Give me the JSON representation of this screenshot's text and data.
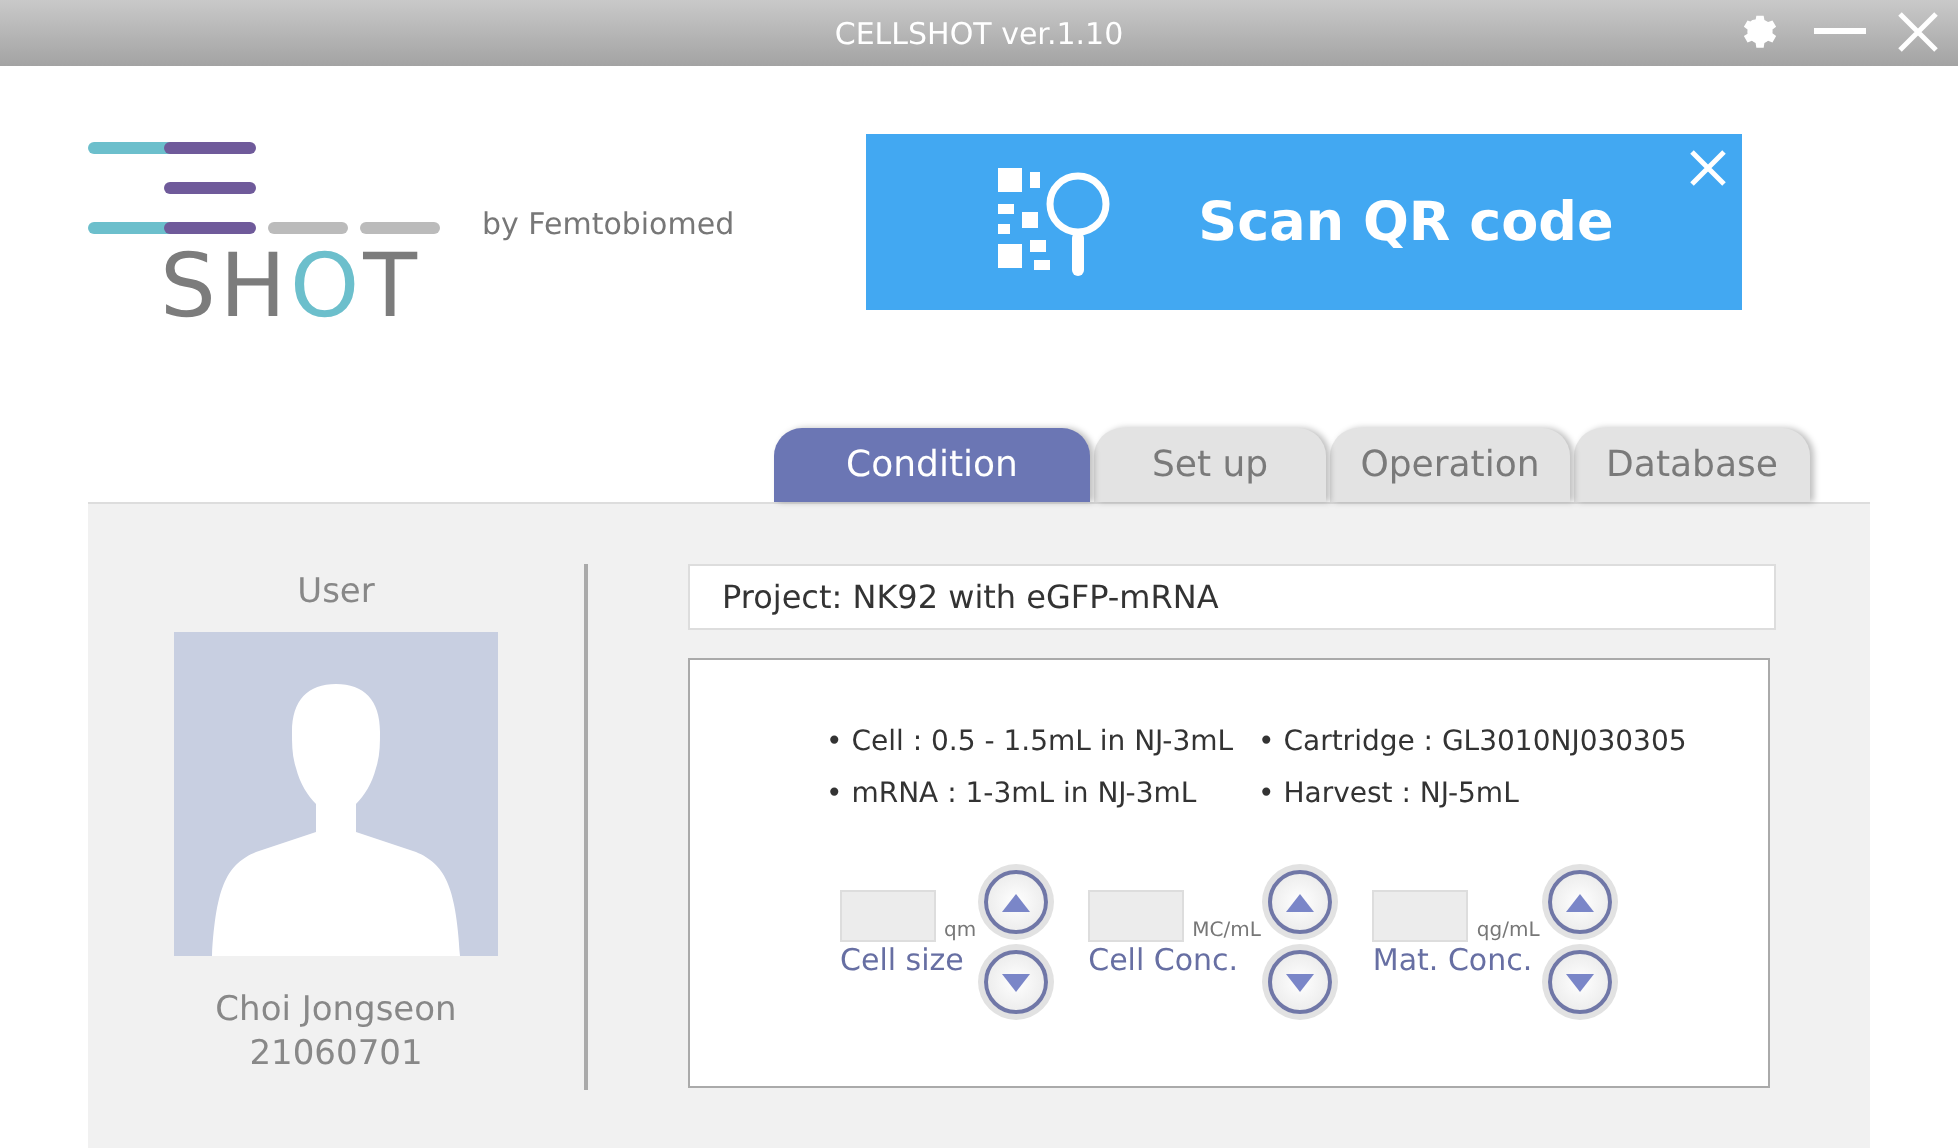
{
  "window": {
    "title": "CELLSHOT ver.1.10"
  },
  "logo": {
    "wordmark": "SHOT",
    "byline": "by Femtobiomed"
  },
  "banner": {
    "label": "Scan QR code"
  },
  "tabs": [
    {
      "label": "Condition",
      "selected": true
    },
    {
      "label": "Set up",
      "selected": false
    },
    {
      "label": "Operation",
      "selected": false
    },
    {
      "label": "Database",
      "selected": false
    }
  ],
  "user": {
    "heading": "User",
    "name": "Choi Jongseon",
    "id": "21060701"
  },
  "project": {
    "value": "Project: NK92 with eGFP-mRNA"
  },
  "details": [
    "• Cell : 0.5 - 1.5mL in NJ-3mL",
    "• Cartridge : GL3010NJ030305",
    "• mRNA : 1-3mL in NJ-3mL",
    "• Harvest : NJ-5mL"
  ],
  "controls": [
    {
      "label": "Cell size",
      "unit": "qm"
    },
    {
      "label": "Cell Conc.",
      "unit": "MC/mL"
    },
    {
      "label": "Mat. Conc.",
      "unit": "qg/mL"
    }
  ]
}
